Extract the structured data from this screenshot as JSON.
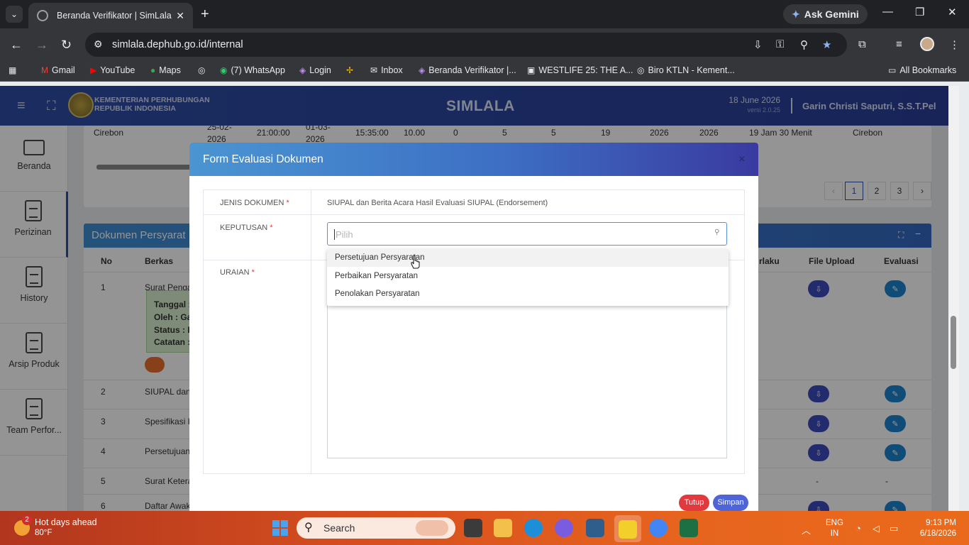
{
  "browser": {
    "tab_title": "Beranda Verifikator | SimLala",
    "url": "simlala.dephub.go.id/internal",
    "ask_gemini": "Ask Gemini",
    "bookmarks": [
      "Gmail",
      "YouTube",
      "Maps",
      "(7) WhatsApp",
      "Login",
      "Inbox",
      "Beranda Verifikator |...",
      "WESTLIFE 25: THE A...",
      "Biro KTLN - Kement..."
    ],
    "all_bookmarks": "All Bookmarks"
  },
  "header": {
    "org_line1": "KEMENTERIAN PERHUBUNGAN",
    "org_line2": "REPUBLIK INDONESIA",
    "app_name": "SIMLALA",
    "date": "18 June 2026",
    "version": "versi 2.0.25",
    "user": "Garin Christi Saputri, S.S.T.Pel"
  },
  "sidebar": {
    "items": [
      {
        "label": "Beranda",
        "icon": "monitor-icon"
      },
      {
        "label": "Perizinan",
        "icon": "document-icon"
      },
      {
        "label": "History",
        "icon": "document-icon"
      },
      {
        "label": "Arsip Produk",
        "icon": "document-icon"
      },
      {
        "label": "Team Perfor..."
      }
    ]
  },
  "background": {
    "row": [
      "Cirebon",
      "25-02-",
      "2026",
      "21:00:00",
      "01-03-",
      "2026",
      "15:35:00",
      "10.00",
      "0",
      "5",
      "5",
      "19",
      "2026",
      "2026",
      "19 Jam 30 Menit",
      "Cirebon"
    ],
    "pages": [
      "1",
      "2",
      "3"
    ],
    "section_title": "Dokumen Persyarat",
    "columns": {
      "no": "No",
      "berkas": "Berkas",
      "berlaku": "rlaku",
      "file_upload": "File Upload",
      "evaluasi": "Evaluasi"
    },
    "rows": [
      {
        "no": "1",
        "berkas": "Surat Pengaj"
      },
      {
        "no": "2",
        "berkas": "SIUPAL dan B"
      },
      {
        "no": "3",
        "berkas": "Spesifikasi Ka"
      },
      {
        "no": "4",
        "berkas": "Persetujuan S"
      },
      {
        "no": "5",
        "berkas": "Surat Keteran"
      },
      {
        "no": "6",
        "berkas": "Daftar Awak"
      }
    ],
    "note_lines": [
      "Tanggal :",
      "Oleh : Ga",
      "Status : P",
      "Catatan :"
    ],
    "dash": "-"
  },
  "modal": {
    "title": "Form Evaluasi Dokumen",
    "close": "×",
    "jenis_label": "JENIS DOKUMEN",
    "jenis_value": "SIUPAL dan Berita Acara Hasil Evaluasi SIUPAL (Endorsement)",
    "keputusan_label": "KEPUTUSAN",
    "keputusan_placeholder": "Pilih",
    "uraian_label": "URAIAN",
    "required_mark": "*",
    "options": [
      "Persetujuan Persyaratan",
      "Perbaikan Persyaratan",
      "Penolakan Persyaratan"
    ],
    "hovered_option": "Persetujuan Persyaratan",
    "btn_tutup": "Tutup",
    "btn_simpan": "Simpan"
  },
  "taskbar": {
    "weather_badge": "2",
    "weather_title": "Hot days ahead",
    "weather_temp": "80°F",
    "search": "Search",
    "lang1": "ENG",
    "lang2": "IN",
    "time": "9:13 PM",
    "date": "6/18/2026"
  },
  "colors": {
    "header_blue": "#2f4ea6",
    "modal_header_start": "#4a95d2",
    "modal_header_end": "#3a3aa0",
    "btn_tutup": "#e03a3f",
    "btn_simpan": "#4f64d6",
    "taskbar": "#e6641e"
  }
}
